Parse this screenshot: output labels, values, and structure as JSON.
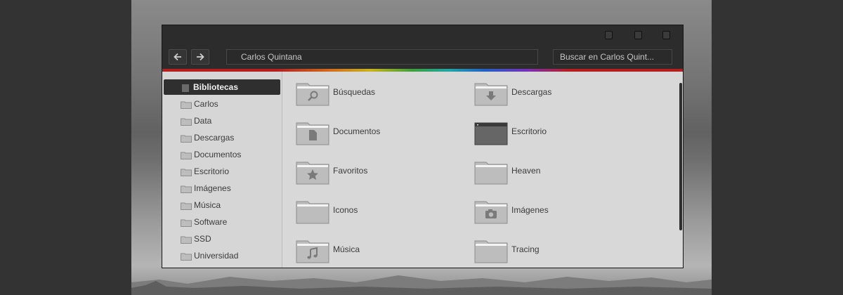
{
  "window": {
    "address": "Carlos Quintana",
    "search_placeholder": "Buscar en Carlos Quint..."
  },
  "sidebar": {
    "items": [
      {
        "label": "Bibliotecas",
        "selected": true
      },
      {
        "label": "Carlos"
      },
      {
        "label": "Data"
      },
      {
        "label": "Descargas"
      },
      {
        "label": "Documentos"
      },
      {
        "label": "Escritorio"
      },
      {
        "label": "Imágenes"
      },
      {
        "label": "Música"
      },
      {
        "label": "Software"
      },
      {
        "label": "SSD"
      },
      {
        "label": "Universidad"
      }
    ]
  },
  "main": {
    "folders": [
      {
        "label": "Búsquedas",
        "icon": "search-icon"
      },
      {
        "label": "Descargas",
        "icon": "download-arrow-icon"
      },
      {
        "label": "Documentos",
        "icon": "document-icon"
      },
      {
        "label": "Escritorio",
        "icon": "desktop-icon"
      },
      {
        "label": "Favoritos",
        "icon": "star-icon"
      },
      {
        "label": "Heaven",
        "icon": "folder-icon"
      },
      {
        "label": "Iconos",
        "icon": "folder-icon"
      },
      {
        "label": "Imágenes",
        "icon": "camera-icon"
      },
      {
        "label": "Música",
        "icon": "music-note-icon"
      },
      {
        "label": "Tracing",
        "icon": "folder-icon"
      }
    ]
  },
  "colors": {
    "window_chrome": "#2c2c2c",
    "content_bg": "#d8d8d8",
    "selected_bg": "#2f2f2f",
    "folder_fill": "#b6b6b6"
  }
}
